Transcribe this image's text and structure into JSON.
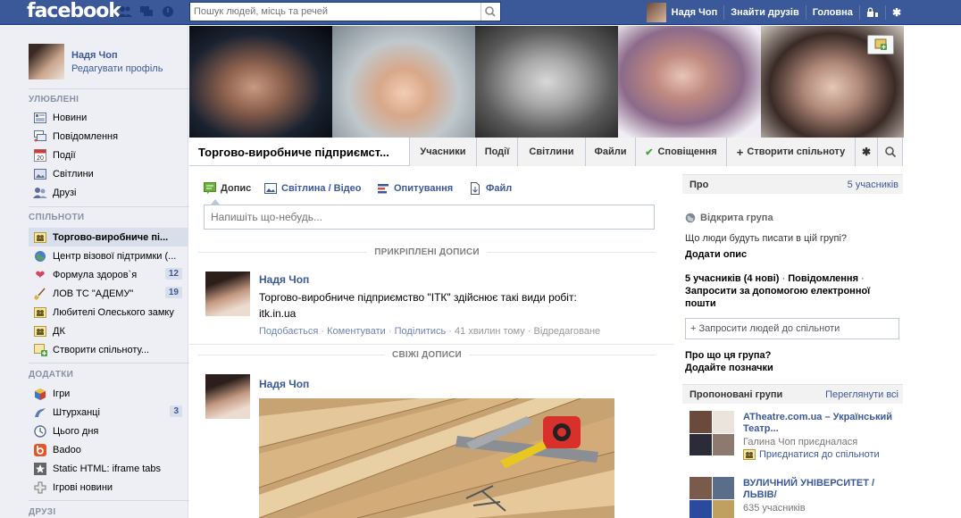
{
  "topbar": {
    "logo": "facebook",
    "search_placeholder": "Пошук людей, місць та речей",
    "user_name": "Надя Чоп",
    "find_friends": "Знайти друзів",
    "home": "Головна"
  },
  "profile": {
    "name": "Надя Чоп",
    "edit": "Редагувати профіль"
  },
  "sidebar": {
    "favorites_header": "УЛЮБЛЕНІ",
    "favorites": [
      {
        "label": "Новини",
        "icon": "news-feed-icon"
      },
      {
        "label": "Повідомлення",
        "icon": "messages-icon"
      },
      {
        "label": "Події",
        "icon": "calendar-icon"
      },
      {
        "label": "Світлини",
        "icon": "photos-icon"
      },
      {
        "label": "Друзі",
        "icon": "friends-icon"
      }
    ],
    "groups_header": "СПІЛЬНОТИ",
    "groups": [
      {
        "label": "Торгово-виробниче пі...",
        "icon": "group-icon"
      },
      {
        "label": "Центр візової підтримки (...",
        "icon": "globe-icon"
      },
      {
        "label": "Формула здоров`я",
        "icon": "heart-icon",
        "badge": "12"
      },
      {
        "label": "ЛОВ ТС \"АДЕМУ\"",
        "icon": "broom-icon",
        "badge": "19"
      },
      {
        "label": "Любителі Олеського замку",
        "icon": "group-icon"
      },
      {
        "label": "ДК",
        "icon": "group-icon"
      },
      {
        "label": "Створити спільноту...",
        "icon": "create-group-icon"
      }
    ],
    "apps_header": "ДОДАТКИ",
    "apps": [
      {
        "label": "Ігри",
        "icon": "games-icon"
      },
      {
        "label": "Штурханці",
        "icon": "poke-icon",
        "badge": "3"
      },
      {
        "label": "Цього дня",
        "icon": "on-this-day-icon"
      },
      {
        "label": "Badoo",
        "icon": "badoo-icon"
      },
      {
        "label": "Static HTML: iframe tabs",
        "icon": "star-icon"
      },
      {
        "label": "Ігрові новини",
        "icon": "game-news-icon"
      }
    ],
    "friends_header": "ДРУЗІ"
  },
  "group": {
    "title": "Торгово-виробниче підприємст...",
    "tabs": {
      "members": "Учасники",
      "events": "Події",
      "photos": "Світлини",
      "files": "Файли",
      "notifications": "Сповіщення",
      "create": "Створити спільноту"
    }
  },
  "composer": {
    "post": "Допис",
    "photo": "Світлина / Відео",
    "poll": "Опитування",
    "file": "Файл",
    "placeholder": "Напишіть що-небудь..."
  },
  "feed": {
    "pinned_header": "ПРИКРІПЛЕНІ ДОПИСИ",
    "recent_header": "СВІЖІ ДОПИСИ",
    "pinned_post": {
      "author": "Надя Чоп",
      "text": "Торгово-виробниче підприємство \"ІТК\" здійснює такі види робіт: itk.in.ua",
      "like": "Подобається",
      "comment": "Коментувати",
      "share": "Поділитись",
      "time": "41 хвилин тому",
      "edited": "Відредаговане"
    },
    "recent_post": {
      "author": "Надя Чоп"
    }
  },
  "about": {
    "header": "Про",
    "members_link": "5 учасників",
    "open_group": "Відкрита група",
    "question": "Що люди будуть писати в цій групі?",
    "add_desc": "Додати опис",
    "stats_members": "5 учасників",
    "stats_new": "(4 нові)",
    "stats_messages": "Повідомлення",
    "invite_email": "Запросити за допомогою електронної пошти",
    "invite_placeholder": "+ Запросити людей до спільноти",
    "about_q": "Про що ця група?",
    "add_tags": "Додайте позначки"
  },
  "suggested": {
    "header": "Пропоновані групи",
    "see_all": "Переглянути всі",
    "items": [
      {
        "name": "ATheatre.com.ua – Український Театр...",
        "sub": "Галина Чоп приєдналася",
        "join": "Приєднатися до спільноти"
      },
      {
        "name": "ВУЛИЧНИЙ УНІВЕРСИТЕТ /ЛЬВІВ/",
        "sub": "635 учасників"
      }
    ]
  },
  "colors": {
    "brand": "#3b5998",
    "sidebar_bg": "#edeff4",
    "link": "#3b5998"
  }
}
